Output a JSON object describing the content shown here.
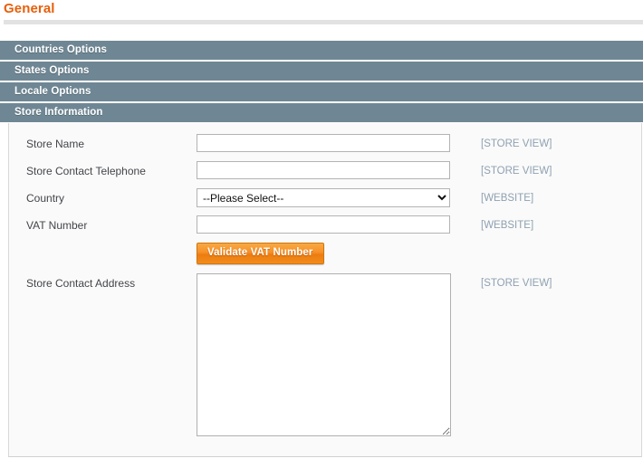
{
  "page": {
    "title": "General"
  },
  "sections": [
    {
      "label": "Countries Options",
      "state": "collapsed"
    },
    {
      "label": "States Options",
      "state": "collapsed"
    },
    {
      "label": "Locale Options",
      "state": "collapsed"
    },
    {
      "label": "Store Information",
      "state": "expanded"
    }
  ],
  "store_information": {
    "fields": [
      {
        "label": "Store Name",
        "type": "text",
        "value": "",
        "placeholder": "",
        "scope": "[STORE VIEW]"
      },
      {
        "label": "Store Contact Telephone",
        "type": "text",
        "value": "",
        "placeholder": "",
        "scope": "[STORE VIEW]"
      },
      {
        "label": "Country",
        "type": "select",
        "value": "--Please Select--",
        "options": [
          "--Please Select--"
        ],
        "scope": "[WEBSITE]"
      },
      {
        "label": "VAT Number",
        "type": "text",
        "value": "",
        "placeholder": "",
        "scope": "[WEBSITE]"
      },
      {
        "label": "Store Contact Address",
        "type": "textarea",
        "value": "",
        "placeholder": "",
        "scope": "[STORE VIEW]"
      }
    ],
    "validate_button": "Validate VAT Number"
  },
  "colors": {
    "title_orange": "#e85f0a",
    "section_bar": "#6f8794",
    "scope_label": "#8fa1b1",
    "button_orange": "#f79027",
    "panel_bg": "#fafafa"
  },
  "icons": {
    "select_chevron": "chevron-down-icon",
    "resize_handle": "resize-handle-icon"
  }
}
